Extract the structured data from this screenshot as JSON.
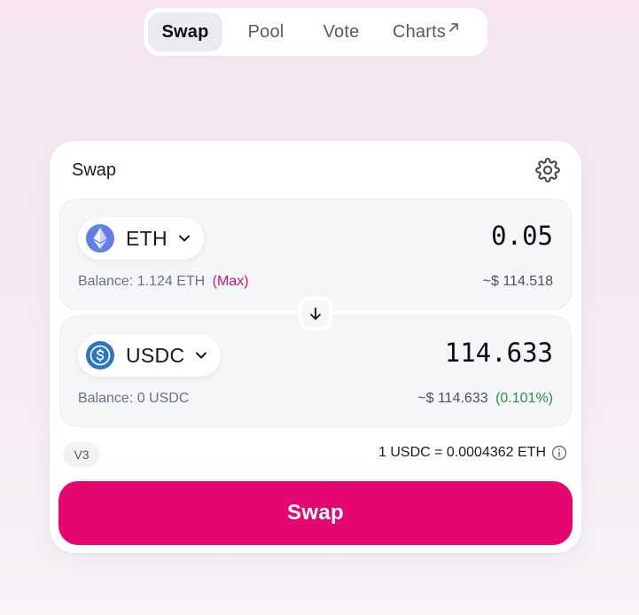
{
  "nav": {
    "items": [
      {
        "label": "Swap",
        "active": true
      },
      {
        "label": "Pool",
        "active": false
      },
      {
        "label": "Vote",
        "active": false
      },
      {
        "label": "Charts",
        "active": false
      }
    ],
    "external_icon": "arrow-up-right-icon"
  },
  "card": {
    "title": "Swap",
    "settings_icon": "gear-icon"
  },
  "input_panel": {
    "token": {
      "symbol": "ETH",
      "icon": "eth-logo-icon"
    },
    "amount": "0.05",
    "balance_label": "Balance: 1.124 ETH",
    "max_label": "(Max)",
    "usd_value": "~$ 114.518"
  },
  "switch": {
    "icon": "arrow-down-icon"
  },
  "output_panel": {
    "token": {
      "symbol": "USDC",
      "icon": "usdc-logo-icon"
    },
    "amount": "114.633",
    "balance_label": "Balance: 0 USDC",
    "usd_value": "~$ 114.633",
    "price_impact": "(0.101%)"
  },
  "route": {
    "version": "V3",
    "rate": "1 USDC = 0.0004362 ETH",
    "info_icon": "info-icon"
  },
  "action": {
    "swap_label": "Swap"
  },
  "colors": {
    "accent": "#e6066f",
    "max_link": "#d0136d",
    "positive": "#2f8f4a",
    "eth_logo": "#627eea",
    "usdc_logo": "#2775ca"
  }
}
